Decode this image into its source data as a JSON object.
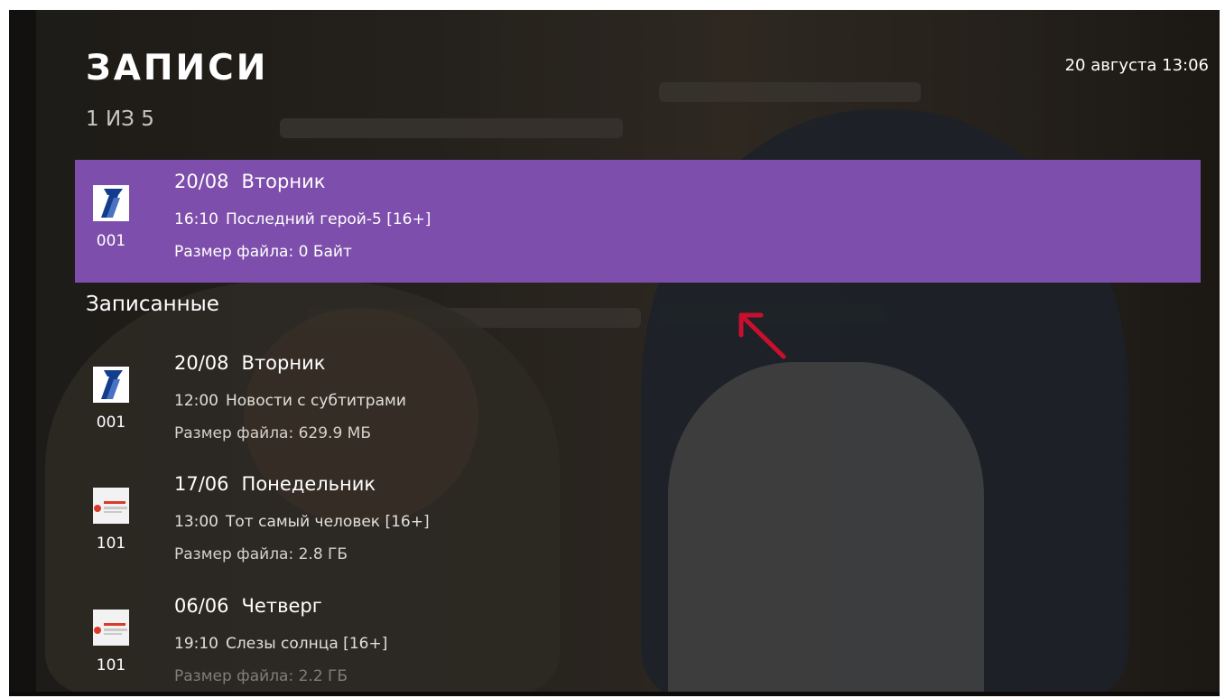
{
  "header": {
    "title": "ЗАПИСИ",
    "counter": "1 ИЗ 5",
    "datetime": "20 августа 13:06"
  },
  "scheduled": {
    "date": "20/08",
    "day": "Вторник",
    "time": "16:10",
    "program": "Последний герой-5 [16+]",
    "size": "Размер файла: 0 Байт",
    "channel_number": "001",
    "channel_icon": "first-channel-icon"
  },
  "section": {
    "title": "Записанные"
  },
  "recordings": [
    {
      "date": "20/08",
      "day": "Вторник",
      "time": "12:00",
      "program": "Новости с субтитрами",
      "size": "Размер файла: 629.9 МБ",
      "channel_number": "001",
      "channel_icon": "first-channel-icon"
    },
    {
      "date": "17/06",
      "day": "Понедельник",
      "time": "13:00",
      "program": "Тот самый человек [16+]",
      "size": "Размер файла: 2.8 ГБ",
      "channel_number": "101",
      "channel_icon": "channel-101-logo-icon"
    },
    {
      "date": "06/06",
      "day": "Четверг",
      "time": "19:10",
      "program": "Слезы солнца [16+]",
      "size": "Размер файла: 2.2 ГБ",
      "channel_number": "101",
      "channel_icon": "channel-101-logo-icon"
    }
  ],
  "colors": {
    "selection": "#7d4eab",
    "annotation_arrow": "#c8102e"
  }
}
